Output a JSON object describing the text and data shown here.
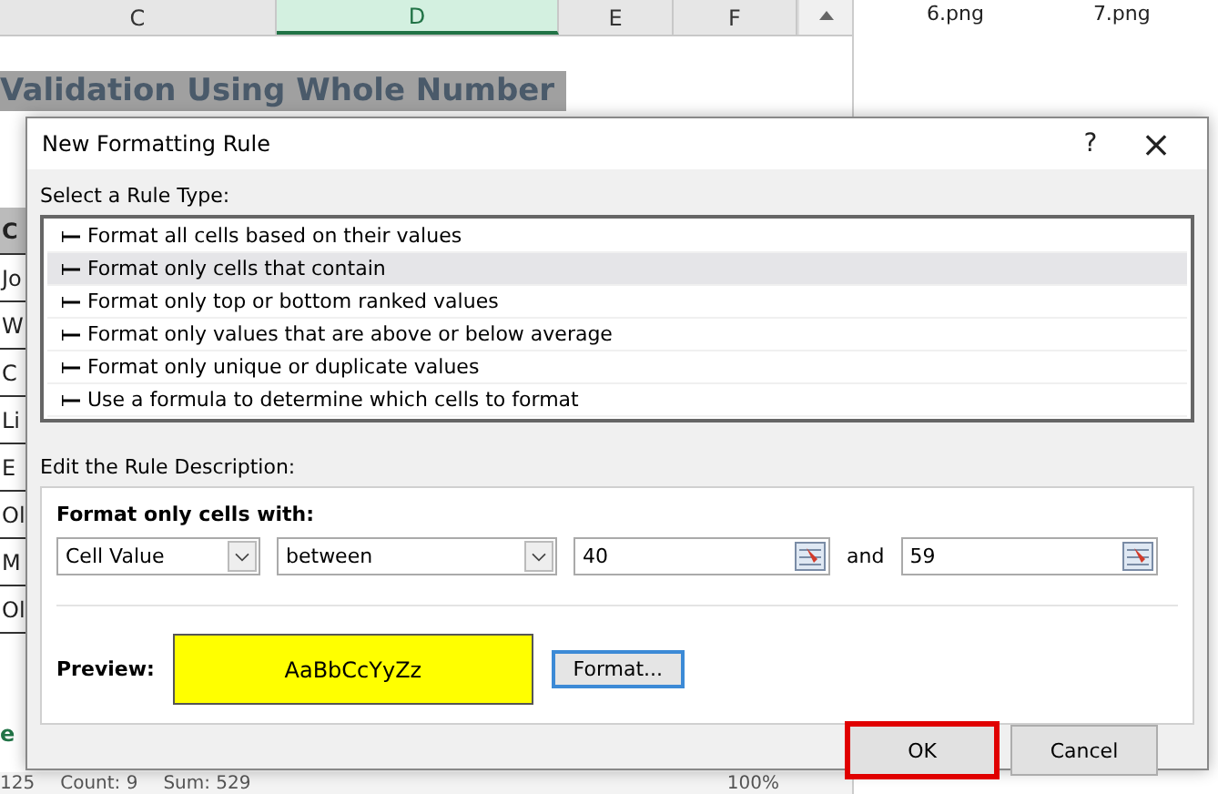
{
  "sheet": {
    "columns": [
      {
        "label": "C",
        "selected": false
      },
      {
        "label": "D",
        "selected": true
      },
      {
        "label": "E",
        "selected": false
      },
      {
        "label": "F",
        "selected": false
      }
    ],
    "title": "Validation Using Whole Number",
    "row_fragments": [
      "C",
      "Jo",
      "W",
      "C",
      "Li",
      "E",
      "Ol",
      "M",
      "Ol"
    ],
    "sheet_tab": "e",
    "status_bar": {
      "cell": "125",
      "count": "Count: 9",
      "sum": "Sum: 529",
      "zoom": "100%"
    }
  },
  "files": [
    "6.png",
    "7.png"
  ],
  "dialog": {
    "title": "New Formatting Rule",
    "help": "?",
    "close": "×",
    "rule_type_label": "Select a Rule Type:",
    "rule_types": [
      {
        "label": "Format all cells based on their values",
        "selected": false
      },
      {
        "label": "Format only cells that contain",
        "selected": true
      },
      {
        "label": "Format only top or bottom ranked values",
        "selected": false
      },
      {
        "label": "Format only values that are above or below average",
        "selected": false
      },
      {
        "label": "Format only unique or duplicate values",
        "selected": false
      },
      {
        "label": "Use a formula to determine which cells to format",
        "selected": false
      }
    ],
    "description_label": "Edit the Rule Description:",
    "condition_label": "Format only cells with:",
    "field": "Cell Value",
    "operator": "between",
    "min": "40",
    "and": "and",
    "max": "59",
    "preview_label": "Preview:",
    "preview_text": "AaBbCcYyZz",
    "format_button": "Format...",
    "buttons": [
      {
        "label": "OK",
        "highlighted": true
      },
      {
        "label": "Cancel",
        "highlighted": false
      }
    ]
  }
}
